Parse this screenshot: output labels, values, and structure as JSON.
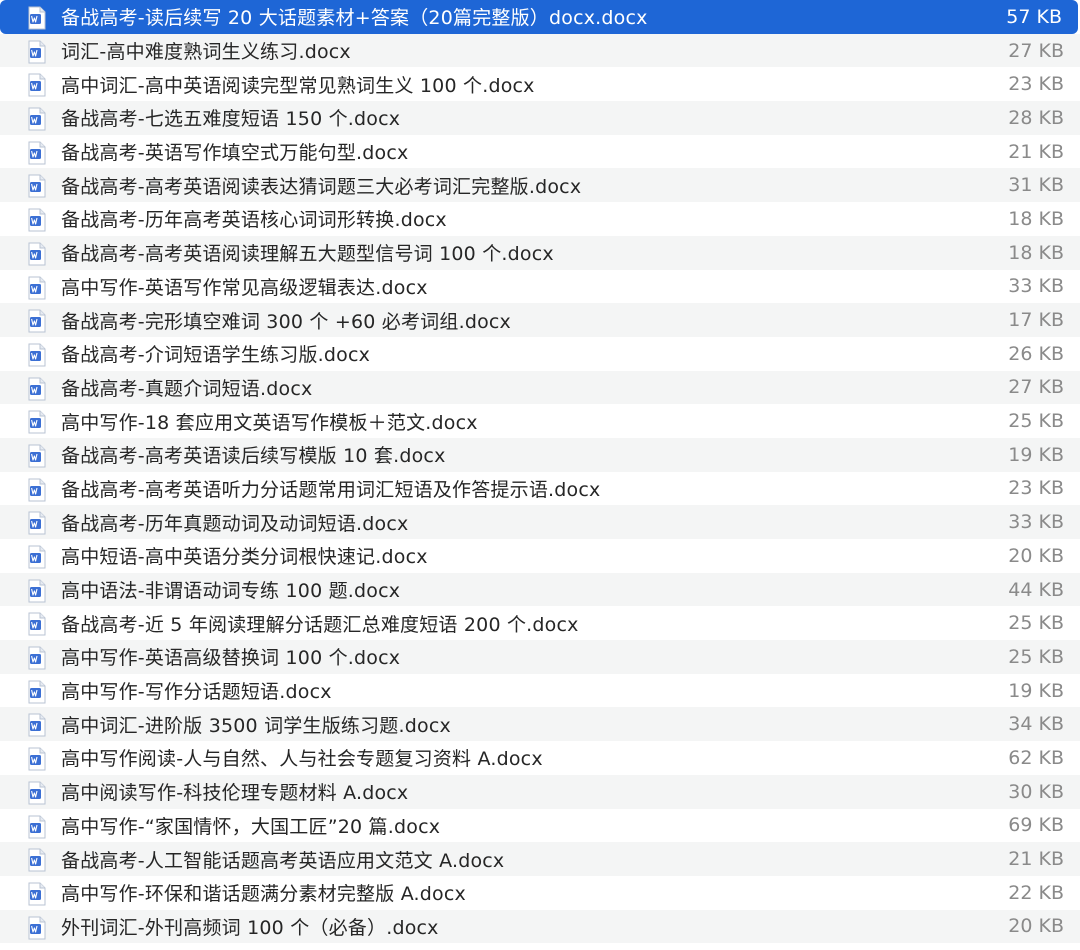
{
  "colors": {
    "selection": "#1e66d6",
    "stripe": "#f4f5f5",
    "name_text": "#262626",
    "size_text": "#8a8a8a",
    "doc_icon_blue": "#3b6fd4"
  },
  "files": [
    {
      "name": "备战高考-读后续写 20 大话题素材+答案（20篇完整版）docx.docx",
      "size": "57 KB",
      "icon": "word-document-icon",
      "selected": true
    },
    {
      "name": "词汇-高中难度熟词生义练习.docx",
      "size": "27 KB",
      "icon": "word-document-icon"
    },
    {
      "name": "高中词汇-高中英语阅读完型常见熟词生义 100 个.docx",
      "size": "23 KB",
      "icon": "word-document-icon"
    },
    {
      "name": "备战高考-七选五难度短语 150 个.docx",
      "size": "28 KB",
      "icon": "word-document-icon"
    },
    {
      "name": "备战高考-英语写作填空式万能句型.docx",
      "size": "21 KB",
      "icon": "word-document-icon"
    },
    {
      "name": "备战高考-高考英语阅读表达猜词题三大必考词汇完整版.docx",
      "size": "31 KB",
      "icon": "word-document-icon"
    },
    {
      "name": "备战高考-历年高考英语核心词词形转换.docx",
      "size": "18 KB",
      "icon": "word-document-icon"
    },
    {
      "name": "备战高考-高考英语阅读理解五大题型信号词 100 个.docx",
      "size": "18 KB",
      "icon": "word-document-icon"
    },
    {
      "name": "高中写作-英语写作常见高级逻辑表达.docx",
      "size": "33 KB",
      "icon": "word-document-icon"
    },
    {
      "name": "备战高考-完形填空难词 300 个 +60 必考词组.docx",
      "size": "17 KB",
      "icon": "word-document-icon"
    },
    {
      "name": "备战高考-介词短语学生练习版.docx",
      "size": "26 KB",
      "icon": "word-document-icon"
    },
    {
      "name": "备战高考-真题介词短语.docx",
      "size": "27 KB",
      "icon": "word-document-icon"
    },
    {
      "name": "高中写作-18 套应用文英语写作模板＋范文.docx",
      "size": "25 KB",
      "icon": "word-document-icon"
    },
    {
      "name": "备战高考-高考英语读后续写模版 10 套.docx",
      "size": "19 KB",
      "icon": "word-document-icon"
    },
    {
      "name": "备战高考-高考英语听力分话题常用词汇短语及作答提示语.docx",
      "size": "23 KB",
      "icon": "word-document-icon"
    },
    {
      "name": "备战高考-历年真题动词及动词短语.docx",
      "size": "33 KB",
      "icon": "word-document-icon"
    },
    {
      "name": "高中短语-高中英语分类分词根快速记.docx",
      "size": "20 KB",
      "icon": "word-document-icon"
    },
    {
      "name": "高中语法-非谓语动词专练 100 题.docx",
      "size": "44 KB",
      "icon": "word-document-icon"
    },
    {
      "name": "备战高考-近 5 年阅读理解分话题汇总难度短语 200 个.docx",
      "size": "25 KB",
      "icon": "word-document-icon"
    },
    {
      "name": "高中写作-英语高级替换词 100 个.docx",
      "size": "25 KB",
      "icon": "word-document-icon"
    },
    {
      "name": "高中写作-写作分话题短语.docx",
      "size": "19 KB",
      "icon": "word-document-icon"
    },
    {
      "name": "高中词汇-进阶版 3500 词学生版练习题.docx",
      "size": "34 KB",
      "icon": "word-document-icon"
    },
    {
      "name": "高中写作阅读-人与自然、人与社会专题复习资料 A.docx",
      "size": "62 KB",
      "icon": "word-document-icon"
    },
    {
      "name": "高中阅读写作-科技伦理专题材料 A.docx",
      "size": "30 KB",
      "icon": "word-document-icon"
    },
    {
      "name": "高中写作-“家国情怀，大国工匠”20 篇.docx",
      "size": "69 KB",
      "icon": "word-document-icon"
    },
    {
      "name": "备战高考-人工智能话题高考英语应用文范文 A.docx",
      "size": "21 KB",
      "icon": "word-document-icon"
    },
    {
      "name": "高中写作-环保和谐话题满分素材完整版 A.docx",
      "size": "22 KB",
      "icon": "word-document-icon"
    },
    {
      "name": "外刊词汇-外刊高频词 100 个（必备）.docx",
      "size": "20 KB",
      "icon": "word-document-icon"
    }
  ]
}
